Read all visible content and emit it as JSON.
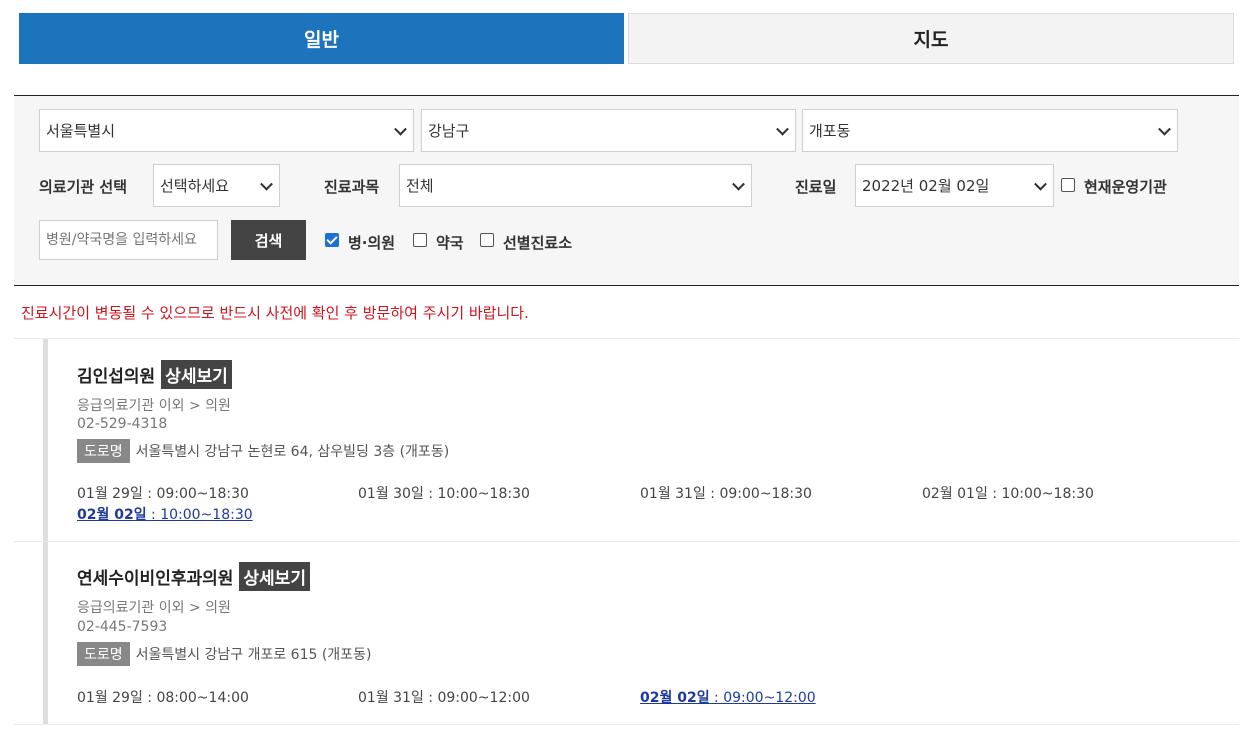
{
  "tabs": {
    "general": "일반",
    "map": "지도"
  },
  "filters": {
    "city": "서울특별시",
    "district": "강남구",
    "dong": "개포동",
    "institution_label": "의료기관 선택",
    "institution_value": "선택하세요",
    "department_label": "진료과목",
    "department_value": "전체",
    "date_label": "진료일",
    "date_value": "2022년 02월 02일",
    "open_now_label": "현재운영기관",
    "search_placeholder": "병원/약국명을 입력하세요",
    "search_button": "검색",
    "type_hospital": "병·의원",
    "type_pharmacy": "약국",
    "type_screening": "선별진료소"
  },
  "notice": "진료시간이 변동될 수 있으므로 반드시 사전에 확인 후 방문하여 주시기 바랍니다.",
  "detail_label": "상세보기",
  "road_label": "도로명",
  "clinics": [
    {
      "name": "김인섭의원",
      "category": "응급의료기관 이외 > 의원",
      "phone": "02-529-4318",
      "address": "서울특별시 강남구 논현로 64, 삼우빌딩 3층 (개포동)",
      "hours": [
        {
          "date": "01월 29일",
          "time": " : 09:00~18:30"
        },
        {
          "date": "01월 30일",
          "time": " : 10:00~18:30"
        },
        {
          "date": "01월 31일",
          "time": " : 09:00~18:30"
        },
        {
          "date": "02월 01일",
          "time": " : 10:00~18:30"
        },
        {
          "date": "02월 02일",
          "time": " : 10:00~18:30"
        }
      ]
    },
    {
      "name": "연세수이비인후과의원",
      "category": "응급의료기관 이외 > 의원",
      "phone": "02-445-7593",
      "address": "서울특별시 강남구 개포로 615 (개포동)",
      "hours": [
        {
          "date": "01월 29일",
          "time": " : 08:00~14:00"
        },
        {
          "date": "01월 31일",
          "time": " : 09:00~12:00"
        },
        {
          "date": "02월 02일",
          "time": " : 09:00~12:00"
        }
      ]
    }
  ],
  "colors": {
    "accent": "#1c74bd",
    "notice": "#d0141e",
    "today": "#1e3a9e"
  }
}
